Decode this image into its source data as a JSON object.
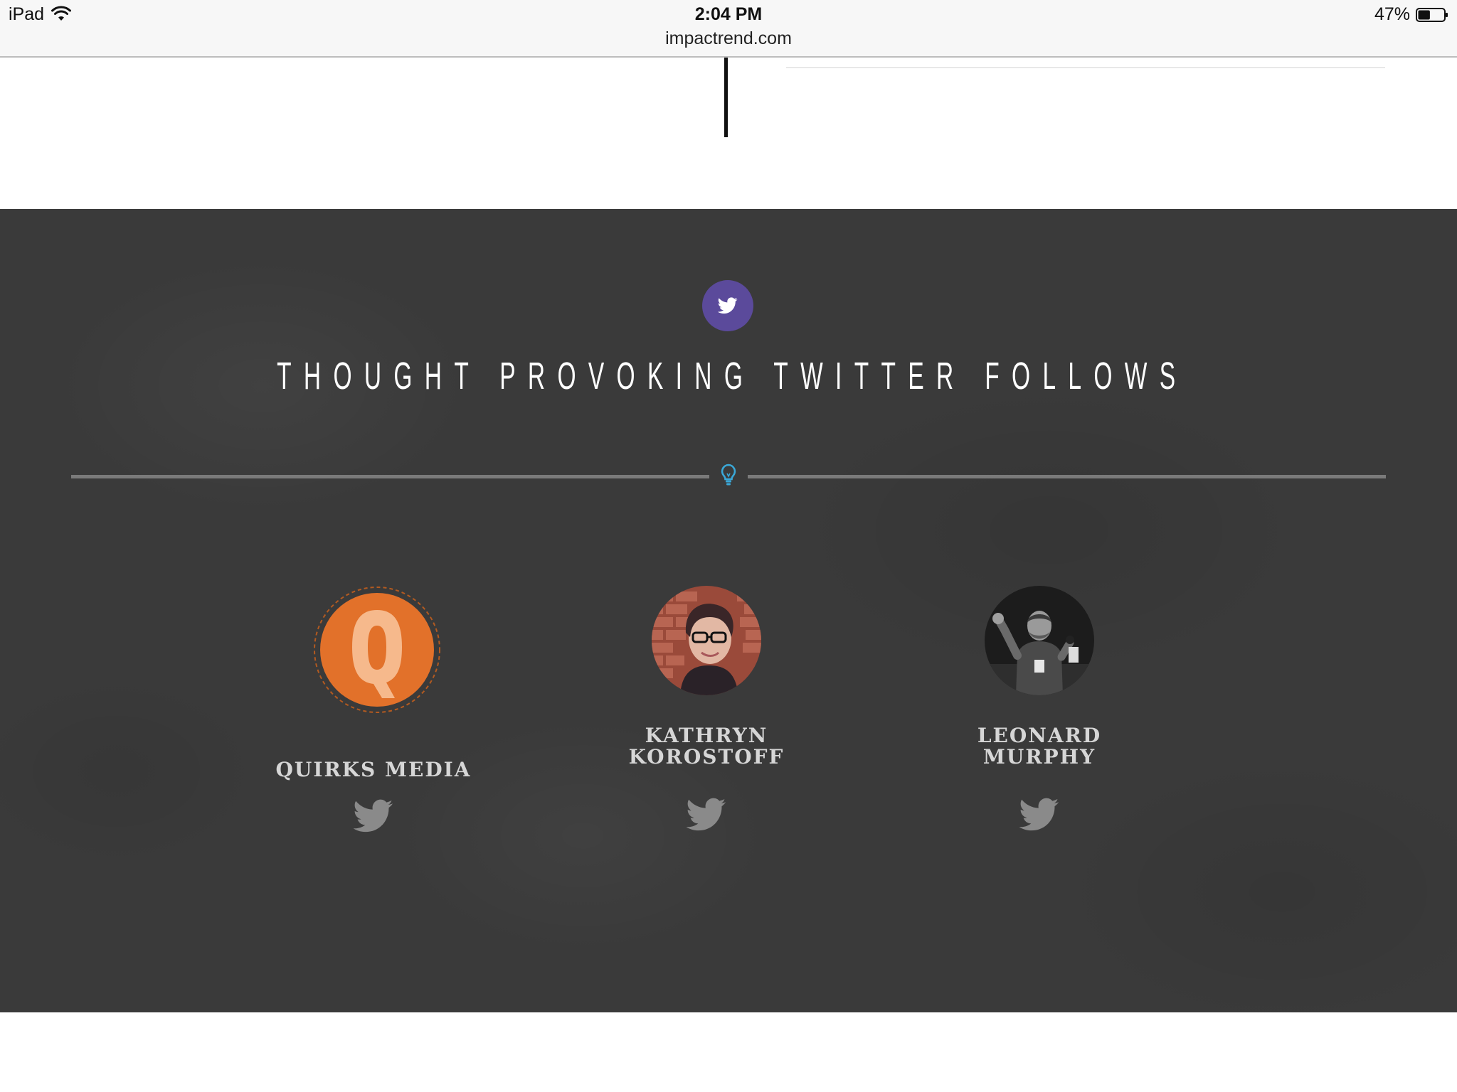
{
  "status_bar": {
    "device": "iPad",
    "time": "2:04 PM",
    "url": "impactrend.com",
    "battery": "47%",
    "battery_level": 0.47,
    "icons": [
      "wifi-icon",
      "battery-icon"
    ]
  },
  "section": {
    "badge_icon": "twitter-icon",
    "title": "THOUGHT PROVOKING TWITTER FOLLOWS",
    "divider_icon": "lightbulb-icon"
  },
  "follows": [
    {
      "name": "QUIRKS MEDIA",
      "avatar": "quirks-logo",
      "icon": "twitter-bird-icon"
    },
    {
      "name_line1": "KATHRYN",
      "name_line2": "KOROSTOFF",
      "avatar": "kathryn-photo",
      "icon": "twitter-bird-icon"
    },
    {
      "name_line1": "LEONARD",
      "name_line2": "MURPHY",
      "avatar": "leonard-photo",
      "icon": "twitter-bird-icon"
    }
  ],
  "colors": {
    "dark_bg": "#3a3a3a",
    "badge_purple": "#5b4a9b",
    "quirks_orange": "#e2712a",
    "bulb_blue": "#3aa8d8",
    "name_text": "#d6d6d6",
    "bird_gray": "#8a8a8a"
  }
}
